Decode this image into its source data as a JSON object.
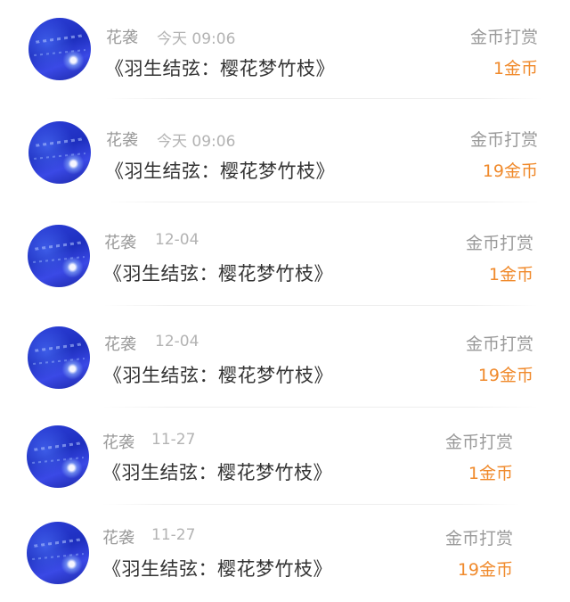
{
  "records": [
    {
      "user": "花袭",
      "time": "今天 09:06",
      "title": "《羽生结弦：樱花梦竹枝》",
      "type": "金币打赏",
      "amount": "1金币"
    },
    {
      "user": "花袭",
      "time": "今天 09:06",
      "title": "《羽生结弦：樱花梦竹枝》",
      "type": "金币打赏",
      "amount": "19金币"
    },
    {
      "user": "花袭",
      "time": "12-04",
      "title": "《羽生结弦：樱花梦竹枝》",
      "type": "金币打赏",
      "amount": "1金币"
    },
    {
      "user": "花袭",
      "time": "12-04",
      "title": "《羽生结弦：樱花梦竹枝》",
      "type": "金币打赏",
      "amount": "19金币"
    },
    {
      "user": "花袭",
      "time": "11-27",
      "title": "《羽生结弦：樱花梦竹枝》",
      "type": "金币打赏",
      "amount": "1金币"
    },
    {
      "user": "花袭",
      "time": "11-27",
      "title": "《羽生结弦：樱花梦竹枝》",
      "type": "金币打赏",
      "amount": "19金币"
    }
  ],
  "colors": {
    "amount": "#f08a2c",
    "meta": "#9a9a9a",
    "title": "#333333",
    "avatar": "#2c3fd8"
  }
}
